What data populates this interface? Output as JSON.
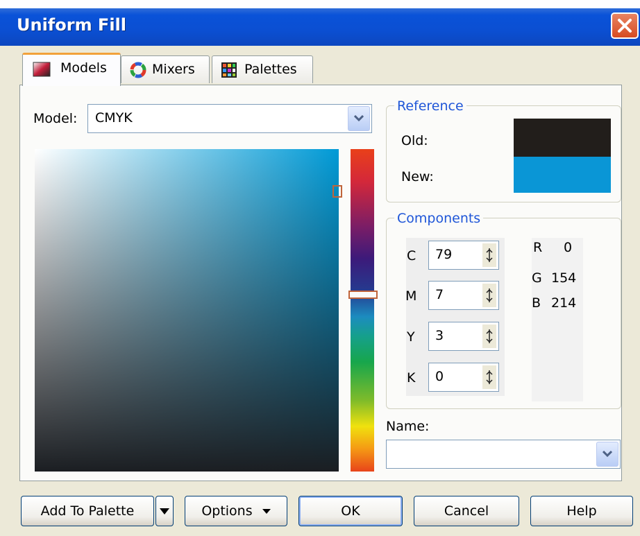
{
  "window": {
    "title": "Uniform Fill"
  },
  "tabs": [
    {
      "label": "Models",
      "icon": "models-icon",
      "active": true
    },
    {
      "label": "Mixers",
      "icon": "mixers-icon",
      "active": false
    },
    {
      "label": "Palettes",
      "icon": "palettes-icon",
      "active": false
    }
  ],
  "model": {
    "label": "Model:",
    "value": "CMYK"
  },
  "reference": {
    "title": "Reference",
    "old_label": "Old:",
    "new_label": "New:",
    "old_color": "#221e1b",
    "new_color": "#0a96d6"
  },
  "components": {
    "title": "Components",
    "cmyk": [
      {
        "label": "C",
        "value": "79"
      },
      {
        "label": "M",
        "value": "7"
      },
      {
        "label": "Y",
        "value": "3"
      },
      {
        "label": "K",
        "value": "0"
      }
    ],
    "rgb": [
      {
        "label": "R",
        "value": "0"
      },
      {
        "label": "G",
        "value": "154"
      },
      {
        "label": "B",
        "value": "214"
      }
    ]
  },
  "name": {
    "label": "Name:",
    "value": ""
  },
  "buttons": {
    "add_to_palette": "Add To Palette",
    "options": "Options",
    "ok": "OK",
    "cancel": "Cancel",
    "help": "Help"
  },
  "colors": {
    "titlebar": "#0b4fd2",
    "accent_text": "#1f56d8",
    "dialog_bg": "#ece9d8"
  }
}
